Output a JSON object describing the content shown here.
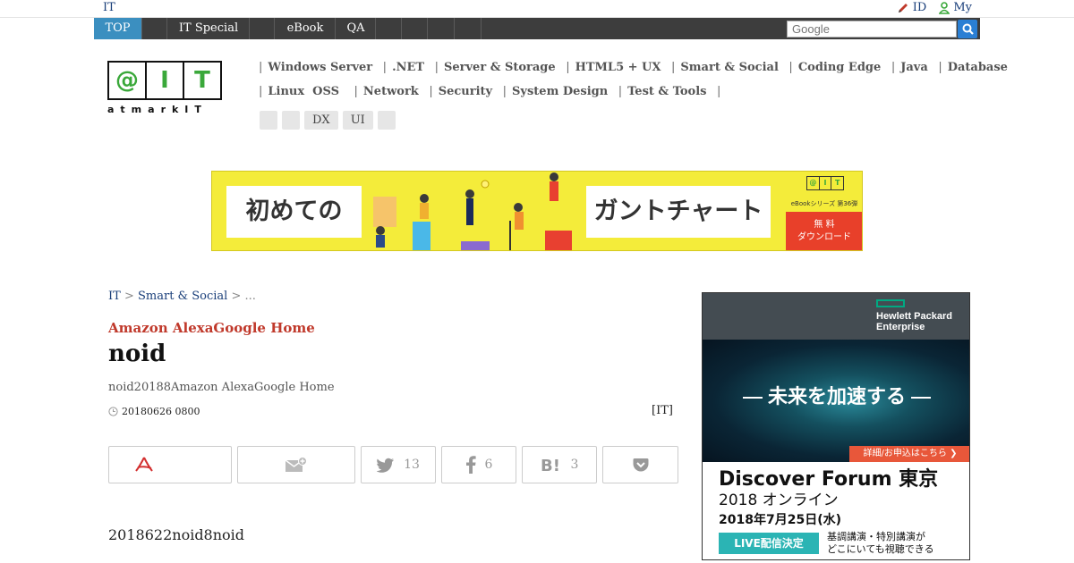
{
  "topbar": {
    "site_label": "IT",
    "id_label": "ID",
    "my_label": "My"
  },
  "nav": {
    "tabs": [
      "TOP",
      "",
      "IT Special",
      "",
      "eBook",
      "QA",
      "",
      "",
      "",
      ""
    ],
    "search_placeholder": "Google"
  },
  "logo": {
    "letters": [
      "@",
      "I",
      "T"
    ],
    "subtitle": "atmarkIT"
  },
  "categories": {
    "row1": [
      "Windows Server",
      ".NET",
      "Server & Storage",
      "HTML5 + UX",
      "Smart & Social",
      "Coding Edge",
      "Java",
      "Database"
    ],
    "row2": [
      "Linux  OSS",
      "Network",
      "Security",
      "System Design",
      "Test & Tools"
    ],
    "chips": [
      "",
      "",
      "DX",
      "UI",
      ""
    ]
  },
  "banner": {
    "left_text": "初めての",
    "right_text": "ガントチャート",
    "series_text": "eBookシリーズ 第36弾",
    "cta_line1": "無 料",
    "cta_line2": "ダウンロード",
    "mini_logo": [
      "@",
      "I",
      "T"
    ]
  },
  "breadcrumb": {
    "home": "IT",
    "sep1": ">",
    "section": "Smart & Social",
    "sep2": ">",
    "current": "..."
  },
  "article": {
    "kicker": "Amazon AlexaGoogle Home",
    "title": "noid",
    "lead": "noid20188Amazon AlexaGoogle Home",
    "date": "20180626 0800",
    "source": "[IT]",
    "body": "2018622noid8noid"
  },
  "share": {
    "twitter_count": "13",
    "facebook_count": "6",
    "hatena_count": "3"
  },
  "side_ad": {
    "brand_line1": "Hewlett Packard",
    "brand_line2": "Enterprise",
    "tagline": "未来を加速する",
    "apply": "詳細/お申込はこちら ❯",
    "event": "Discover Forum 東京",
    "edition": "2018 オンライン",
    "date": "2018年7月25日(水)",
    "live": "LIVE配信決定",
    "note_line1": "基調講演・特別講演が",
    "note_line2": "どこにいても視聴できる"
  },
  "colors": {
    "nav_bg": "#3d3d3d",
    "nav_active": "#3b8fc0",
    "kicker": "#c0392b",
    "link": "#1a3f7a",
    "banner_bg": "#f4ec3a"
  }
}
